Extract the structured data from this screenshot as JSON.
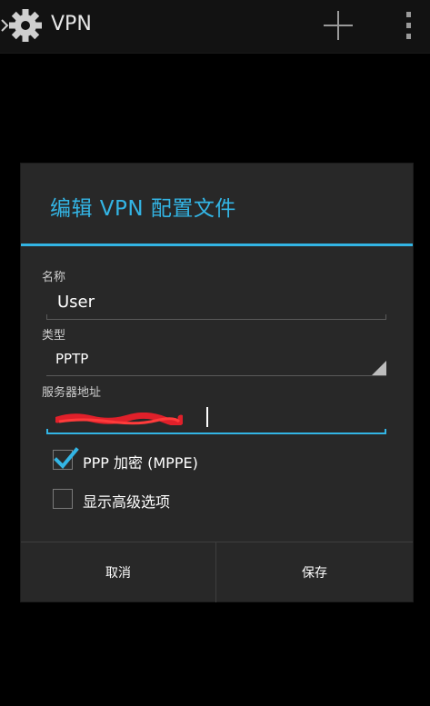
{
  "action_bar": {
    "title": "VPN",
    "add_icon": "plus-icon",
    "overflow_icon": "overflow-menu-icon",
    "settings_icon": "gear-icon"
  },
  "dialog": {
    "title": "编辑 VPN 配置文件",
    "fields": {
      "name_label": "名称",
      "name_value": "User",
      "type_label": "类型",
      "type_value": "PPTP",
      "server_label": "服务器地址",
      "server_value": "[redacted]"
    },
    "checkboxes": [
      {
        "label": "PPP 加密 (MPPE)",
        "checked": true
      },
      {
        "label": "显示高级选项",
        "checked": false
      }
    ],
    "buttons": {
      "cancel": "取消",
      "save": "保存"
    }
  },
  "colors": {
    "accent": "#33b5e5",
    "dialog_bg": "#282828",
    "redaction": "#e0202a"
  }
}
